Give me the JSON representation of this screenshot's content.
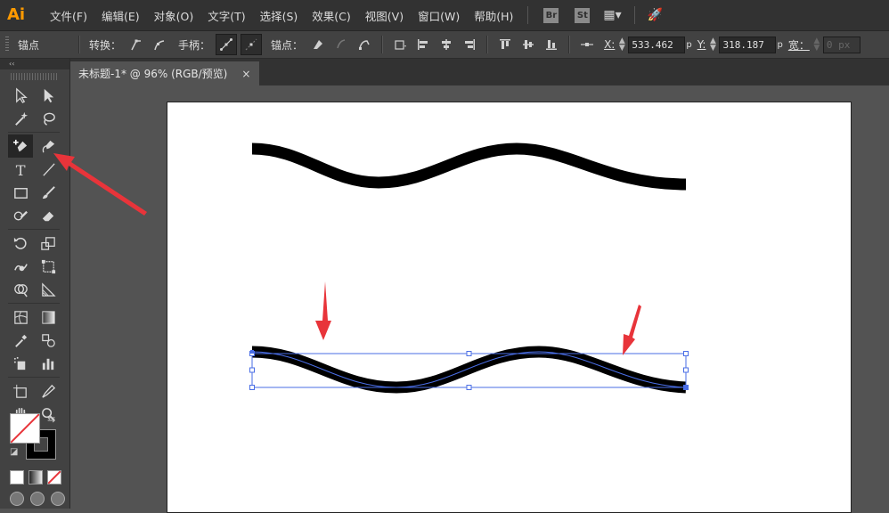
{
  "app": {
    "logo": "Ai"
  },
  "menu": [
    "文件(F)",
    "编辑(E)",
    "对象(O)",
    "文字(T)",
    "选择(S)",
    "效果(C)",
    "视图(V)",
    "窗口(W)",
    "帮助(H)"
  ],
  "bridge_badges": [
    "Br",
    "St"
  ],
  "control_bar": {
    "anchor_label": "锚点",
    "convert_label": "转换：",
    "handles_label": "手柄：",
    "anchors_label": "锚点：",
    "x_label": "X:",
    "x_value": "533.462",
    "x_unit": "p",
    "y_label": "Y:",
    "y_value": "318.187",
    "y_unit": "p",
    "w_label": "宽：",
    "w_value": "0 px"
  },
  "document": {
    "tab_title": "未标题-1* @ 96% (RGB/预览)",
    "close": "×"
  },
  "tools_panel": {
    "collapse": "‹‹"
  },
  "colors": {
    "accent_red": "#e8343a",
    "selection_blue": "#4a6ee6",
    "panel": "#424242",
    "menubar": "#323232"
  }
}
